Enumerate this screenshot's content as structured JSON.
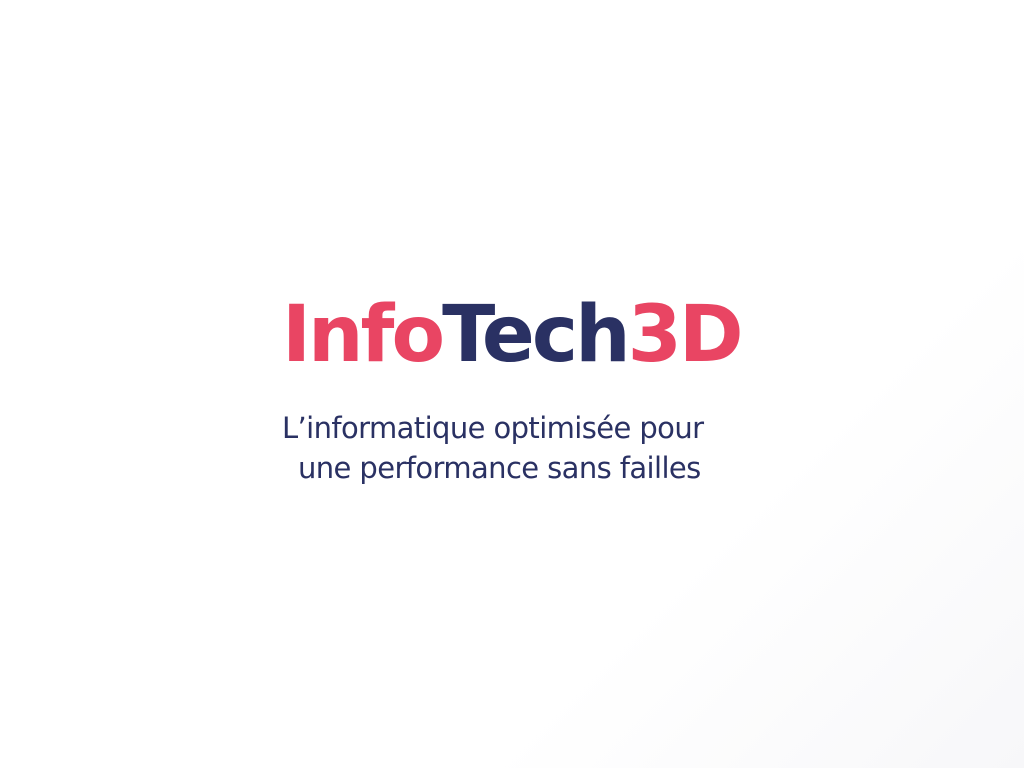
{
  "brand": {
    "logo_parts": {
      "info": "Info",
      "tech": "Tech",
      "suffix": "3D"
    },
    "tagline_line1": "L’informatique optimisée pour",
    "tagline_line2": "une performance sans failles"
  },
  "colors": {
    "accent": "#e94563",
    "navy": "#2a3163",
    "background": "#ffffff"
  }
}
